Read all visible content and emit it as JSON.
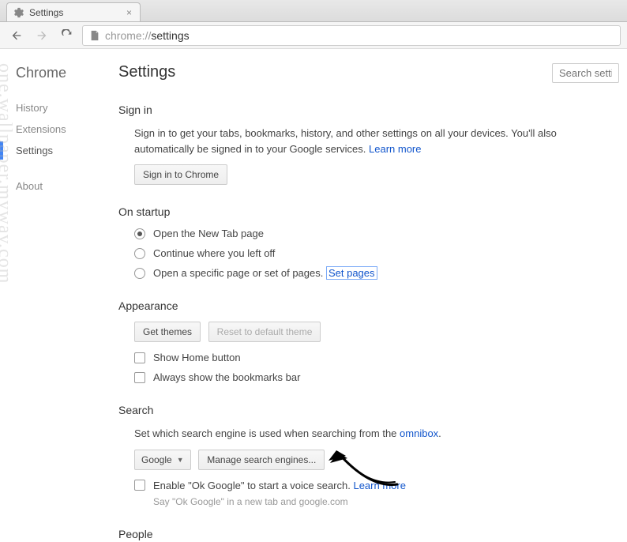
{
  "tab": {
    "title": "Settings"
  },
  "address": {
    "prefix": "chrome://",
    "path": "settings"
  },
  "sidebar": {
    "title": "Chrome",
    "items": [
      "History",
      "Extensions",
      "Settings",
      "About"
    ]
  },
  "page": {
    "heading": "Settings",
    "search_placeholder": "Search setting"
  },
  "signin": {
    "title": "Sign in",
    "desc1": "Sign in to get your tabs, bookmarks, history, and other settings on all your devices. You'll also automatically be signed in to your Google services. ",
    "learn_more": "Learn more",
    "button": "Sign in to Chrome"
  },
  "startup": {
    "title": "On startup",
    "opt1": "Open the New Tab page",
    "opt2": "Continue where you left off",
    "opt3": "Open a specific page or set of pages. ",
    "set_pages": "Set pages"
  },
  "appearance": {
    "title": "Appearance",
    "get_themes": "Get themes",
    "reset_theme": "Reset to default theme",
    "show_home": "Show Home button",
    "show_bookmarks": "Always show the bookmarks bar"
  },
  "search": {
    "title": "Search",
    "desc": "Set which search engine is used when searching from the ",
    "omnibox_link": "omnibox",
    "engine": "Google",
    "manage": "Manage search engines...",
    "enable_ok": "Enable \"Ok Google\" to start a voice search. ",
    "learn_more": "Learn more",
    "note": "Say \"Ok Google\" in a new tab and google.com"
  },
  "people": {
    "title": "People"
  },
  "watermark": "one.wallpaper.myway.com"
}
